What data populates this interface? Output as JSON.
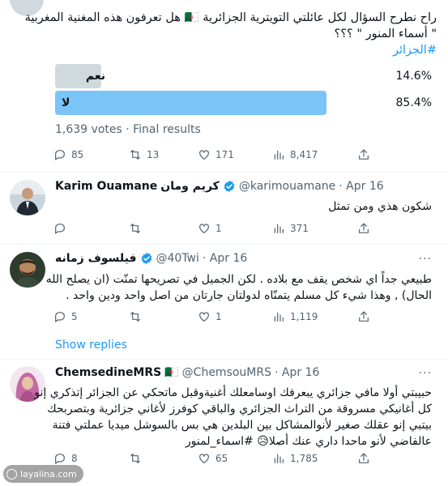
{
  "poll_tweet": {
    "text_line1": "راح نطرح السؤال لكل عائلتي التويترية الجزائرية 🇩🇿 هل تعرفون هذه المغنية المغربية",
    "text_line2": "\" أسماء المنور \" ؟؟؟",
    "hashtag": "#الجزائر",
    "poll": {
      "options": [
        {
          "label": "نعم",
          "percent_text": "14.6%",
          "value": 14.6,
          "color": "#cfd9de"
        },
        {
          "label": "لا",
          "percent_text": "85.4%",
          "value": 85.4,
          "color": "#7ac5f7"
        }
      ],
      "votes_text": "1,639 votes · Final results"
    },
    "actions": {
      "replies": "85",
      "retweets": "13",
      "likes": "171",
      "views": "8,417"
    }
  },
  "replies": [
    {
      "name": "Karim Ouamane",
      "name_ar": "كريم ومان",
      "handle": "@karimouamane",
      "date": "· Apr 16",
      "text_lines": [
        "شكون هذي ومن تمثل"
      ],
      "actions": {
        "replies": "",
        "retweets": "",
        "likes": "1",
        "views": "371"
      }
    },
    {
      "name": "فيلسوف زمانه",
      "handle": "@40Twi",
      "date": "· Apr 16",
      "text_lines": [
        "طبيعي جداً اي شخص يقف مع بلاده . لكن الجميل في تصريحها تمنّت (ان يصلح الله",
        "الحال) , وهذا شيء كل مسلم يتمنّاه لدولتان جارتان من اصل واحد ودين واحد ."
      ],
      "actions": {
        "replies": "5",
        "retweets": "",
        "likes": "1",
        "views": "1,119"
      }
    },
    {
      "name": "ChemsedineMRS",
      "flag": "🇩🇿",
      "handle": "@ChemsouMRS",
      "date": "· Apr 16",
      "text_lines": [
        "حبيبتي أولا مافي جزائري يبعرفك اوسامعلك أغنيةوقبل ماتحكي عن الجزائر إتذكري إنو",
        "كل أغانيكي مسروقة من التراث الجزائري والباقي كوفرز لأغاني جزائرية وبتصربحك",
        "بيتبي إنو عقلك صغير لأنوالمشاكل بين البلدين هي بس بالسوشل ميديا عملتي فتنة",
        "عالفاضي لأنو ماحدا داري عنك أصلا😥 #اسماء_لمنور"
      ],
      "actions": {
        "replies": "8",
        "retweets": "",
        "likes": "65",
        "views": "1,785"
      }
    }
  ],
  "show_replies": "Show replies",
  "more": "···",
  "watermark": "layalina.com",
  "colors": {
    "accent": "#1d9bf0",
    "muted": "#536471",
    "poll_winner": "#7ac5f7",
    "poll_loser": "#cfd9de"
  }
}
